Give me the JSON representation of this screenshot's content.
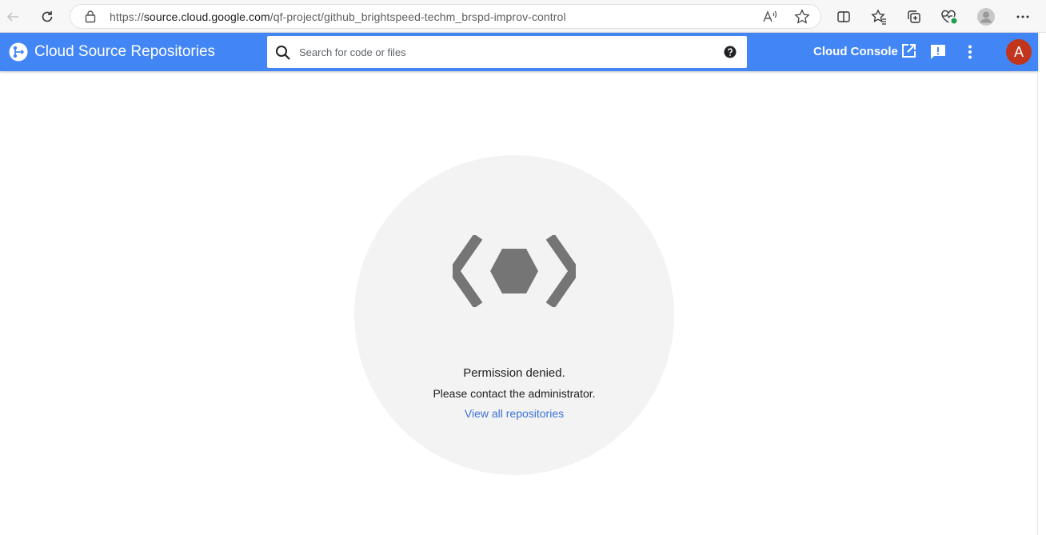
{
  "browser": {
    "url_prefix": "https://",
    "url_domain": "source.cloud.google.com",
    "url_path": "/qf-project/github_brightspeed-techm_brspd-improv-control"
  },
  "header": {
    "title": "Cloud Source Repositories",
    "search_placeholder": "Search for code or files",
    "cloud_console_label": "Cloud Console",
    "avatar_initial": "A",
    "colors": {
      "header_bg": "#4285f4",
      "avatar_bg": "#c1351d"
    }
  },
  "main": {
    "message_title": "Permission denied.",
    "message_body": "Please contact the administrator.",
    "link_label": "View all repositories",
    "link_color": "#3c72d6",
    "icon": "repository-icon"
  }
}
